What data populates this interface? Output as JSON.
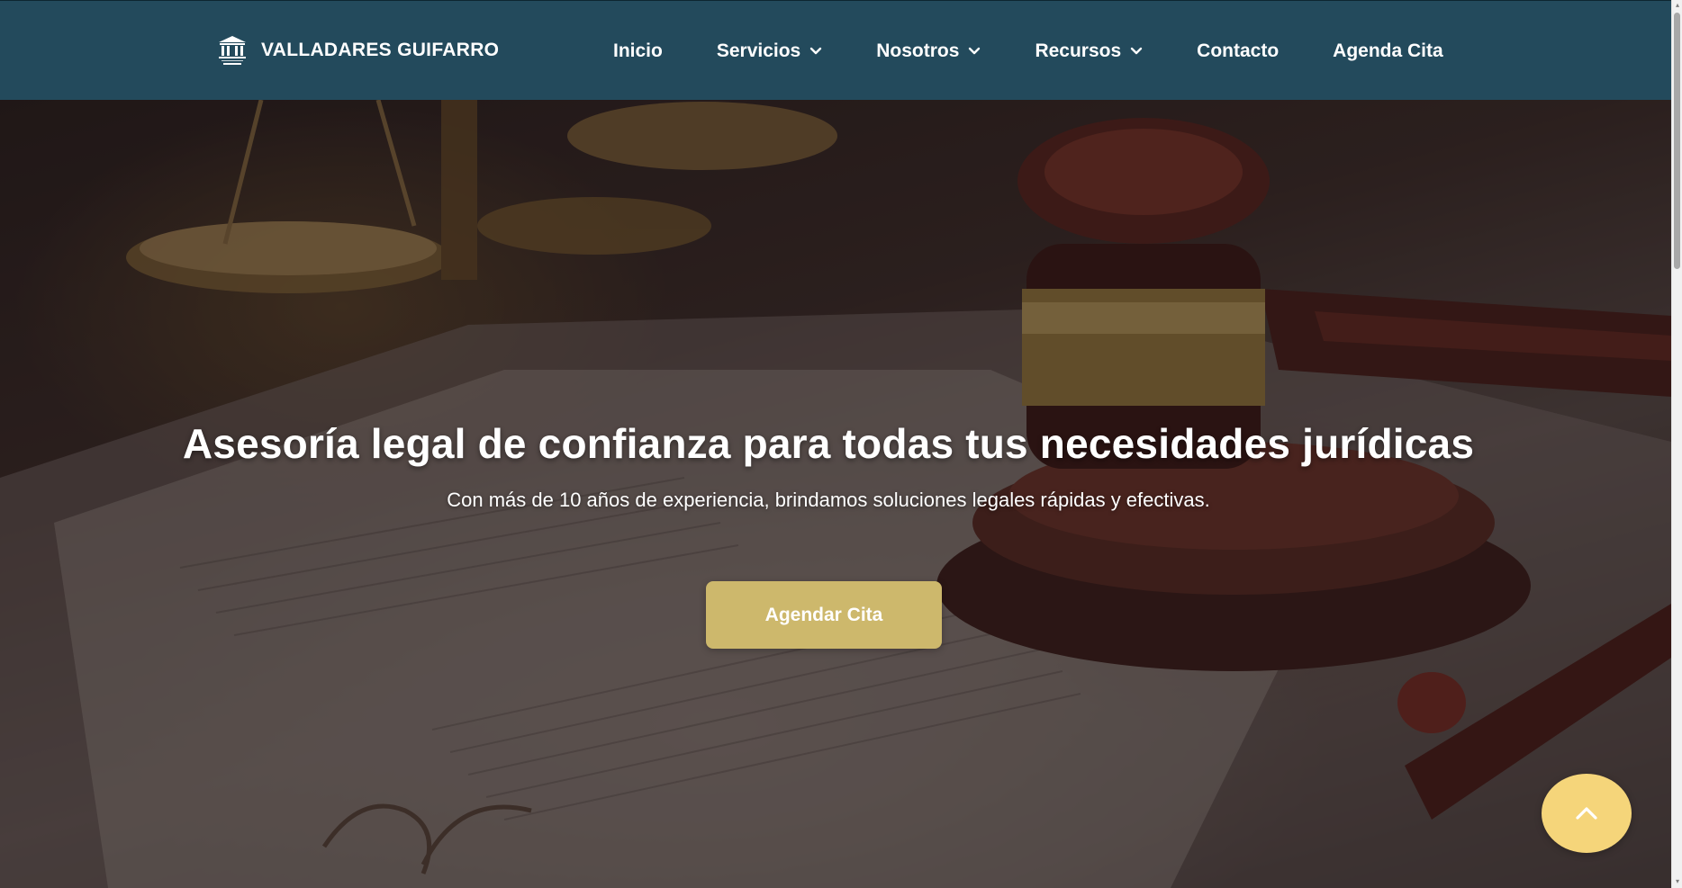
{
  "header": {
    "brand_name": "VALLADARES GUIFARRO",
    "logo_icon": "courthouse-icon",
    "nav": [
      {
        "label": "Inicio",
        "has_dropdown": false
      },
      {
        "label": "Servicios",
        "has_dropdown": true
      },
      {
        "label": "Nosotros",
        "has_dropdown": true
      },
      {
        "label": "Recursos",
        "has_dropdown": true
      },
      {
        "label": "Contacto",
        "has_dropdown": false
      },
      {
        "label": "Agenda Cita",
        "has_dropdown": false
      }
    ]
  },
  "hero": {
    "title": "Asesoría legal de confianza para todas tus necesidades jurídicas",
    "subtitle": "Con más de 10 años de experiencia, brindamos soluciones legales rápidas y efectivas.",
    "cta_label": "Agendar Cita",
    "background_icon": "gavel-and-scales-image"
  },
  "scroll_top": {
    "icon": "chevron-up-icon"
  },
  "colors": {
    "header_bg": "#234a5c",
    "cta_bg": "#cdb86c",
    "scroll_top_bg": "#f5d57a",
    "text": "#ffffff"
  }
}
